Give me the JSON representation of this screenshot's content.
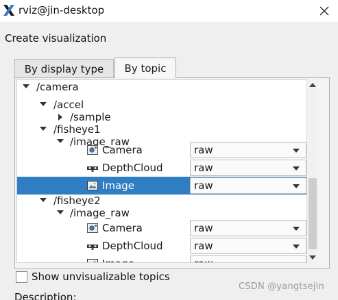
{
  "window": {
    "title": "rviz@jin-desktop"
  },
  "dialog": {
    "heading": "Create visualization"
  },
  "tabs": [
    {
      "label": "By display type",
      "active": false
    },
    {
      "label": "By topic",
      "active": true
    }
  ],
  "tree": {
    "rows": [
      {
        "label": "/camera",
        "expanded": true
      },
      {
        "label": "/accel",
        "expanded": true
      },
      {
        "label": "/sample",
        "expanded": false
      },
      {
        "label": "/fisheye1",
        "expanded": true
      },
      {
        "label": "/image_raw",
        "expanded": true
      },
      {
        "label": "Camera",
        "icon": "camera-display-icon",
        "transport": "raw"
      },
      {
        "label": "DepthCloud",
        "icon": "depthcloud-display-icon",
        "transport": "raw"
      },
      {
        "label": "Image",
        "icon": "image-display-icon",
        "transport": "raw",
        "selected": true
      },
      {
        "label": "/fisheye2",
        "expanded": true
      },
      {
        "label": "/image_raw",
        "expanded": true
      },
      {
        "label": "Camera",
        "icon": "camera-display-icon",
        "transport": "raw"
      },
      {
        "label": "DepthCloud",
        "icon": "depthcloud-display-icon",
        "transport": "raw"
      },
      {
        "label": "Image",
        "icon": "image-display-icon",
        "transport": "raw"
      }
    ]
  },
  "options": {
    "show_unvisualizable_label": "Show unvisualizable topics",
    "show_unvisualizable_checked": false
  },
  "description": {
    "label": "Description:"
  },
  "watermark": "CSDN @yangtsejin",
  "colors": {
    "selection": "#2f7ec4",
    "logo_primary": "#1a1a1a",
    "logo_accent": "#3b7bbf"
  }
}
